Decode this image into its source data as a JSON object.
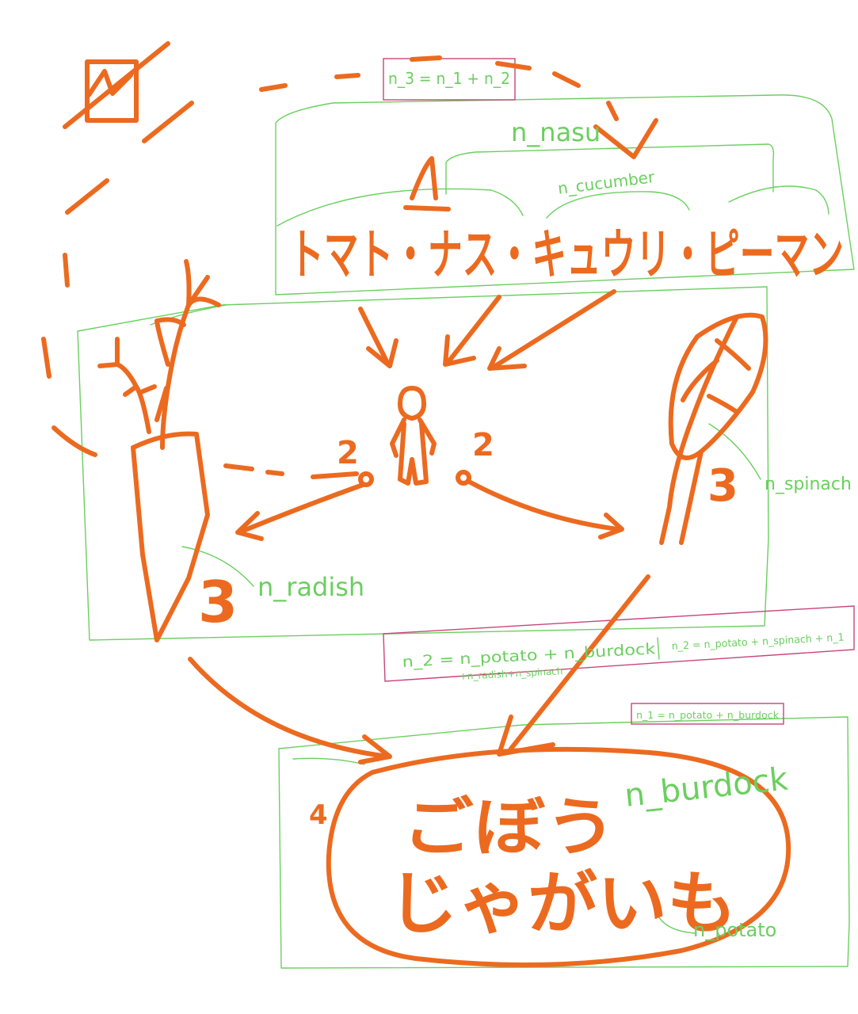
{
  "diagram": {
    "row_vegetables": "トマト・ナス・キュウリ・ピーマン",
    "bottom_line1": "ごぼう",
    "bottom_line2": "じゃがいも",
    "numbers": {
      "left_edge": "2",
      "right_edge": "2",
      "radish": "3",
      "spinach": "3",
      "bottom_group": "4"
    },
    "labels": {
      "nasu": "n_nasu",
      "cucumber": "n_cucumber",
      "spinach": "n_spinach",
      "radish": "n_radish",
      "burdock": "n_burdock",
      "potato": "n_potato"
    },
    "equations": {
      "top": "n_3 = n_1 + n_2",
      "middle_a": "n_2 = n_potato + n_burdock",
      "middle_a2": "+n_radish+n_spinach",
      "middle_b": "n_2 = n_potato + n_spinach + n_1",
      "bottom": "n_1 = n_potato + n_burdock"
    },
    "colors": {
      "ink": "#ec6a1f",
      "box": "#6bcf5f",
      "equation_box": "#c9457a"
    }
  }
}
